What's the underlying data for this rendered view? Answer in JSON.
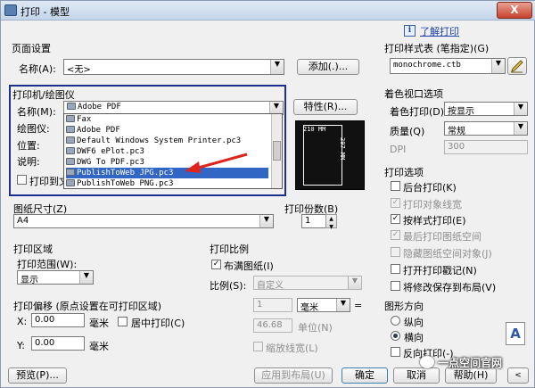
{
  "window": {
    "title": "打印 - 模型",
    "close": "X"
  },
  "help": {
    "icon": "i",
    "link": "了解打印"
  },
  "page_setup": {
    "title": "页面设置",
    "name_label": "名称(A):",
    "name_value": "<无>",
    "add_button": "添加(.)..."
  },
  "printer": {
    "title": "打印机/绘图仪",
    "name_label": "名称(M):",
    "name_value": "Adobe PDF",
    "plotter_label": "绘图仪:",
    "location_label": "位置:",
    "desc_label": "说明:",
    "print_to_file": "打印到文",
    "properties_button": "特性(R)...",
    "dropdown_items": [
      "Fax",
      "Adobe PDF",
      "Default Windows System Printer.pc3",
      "DWF6 ePlot.pc3",
      "DWG To PDF.pc3",
      "PublishToWeb JPG.pc3",
      "PublishToWeb PNG.pc3"
    ],
    "selected_index": 5
  },
  "preview": {
    "width_label": "210 MM",
    "height_label": "297 MM"
  },
  "paper_size": {
    "title": "图纸尺寸(Z)",
    "value": "A4"
  },
  "copies": {
    "title": "打印份数(B)",
    "value": "1"
  },
  "print_area": {
    "title": "打印区域",
    "range_label": "打印范围(W):",
    "range_value": "显示"
  },
  "print_scale": {
    "title": "打印比例",
    "fit_paper": "布满图纸(I)",
    "scale_label": "比例(S):",
    "scale_value": "自定义",
    "value1": "1",
    "unit1": "毫米",
    "eq": "=",
    "value2": "46.68",
    "unit2": "单位(N)",
    "scale_lineweights": "缩放线宽(L)"
  },
  "print_offset": {
    "title": "打印偏移 (原点设置在可打印区域)",
    "x_label": "X:",
    "x_value": "0.00",
    "y_label": "Y:",
    "y_value": "0.00",
    "unit": "毫米",
    "center": "居中打印(C)"
  },
  "plot_style": {
    "title": "打印样式表 (笔指定)(G)",
    "value": "monochrome.ctb"
  },
  "shaded_viewport": {
    "title": "着色视口选项",
    "shade_label": "着色打印(D)",
    "shade_value": "按显示",
    "quality_label": "质量(Q)",
    "quality_value": "常规",
    "dpi_label": "DPI",
    "dpi_value": "300"
  },
  "print_options": {
    "title": "打印选项",
    "items": [
      {
        "label": "后台打印(K)",
        "checked": false,
        "enabled": true
      },
      {
        "label": "打印对象线宽",
        "checked": true,
        "enabled": false
      },
      {
        "label": "按样式打印(E)",
        "checked": true,
        "enabled": true
      },
      {
        "label": "最后打印图纸空间",
        "checked": true,
        "enabled": false
      },
      {
        "label": "隐藏图纸空间对象(J)",
        "checked": false,
        "enabled": false
      },
      {
        "label": "打开打印戳记(N)",
        "checked": false,
        "enabled": true
      },
      {
        "label": "将修改保存到布局(V)",
        "checked": false,
        "enabled": true
      }
    ]
  },
  "orientation": {
    "title": "图形方向",
    "portrait": "纵向",
    "landscape": "横向",
    "reverse": "反向打印(-)",
    "icon_letter": "A"
  },
  "footer": {
    "preview": "预览(P)...",
    "apply_layout": "应用到布局(U)",
    "ok": "确定",
    "cancel": "取消",
    "help": "帮助(H)"
  },
  "watermark": "一点空间官网"
}
